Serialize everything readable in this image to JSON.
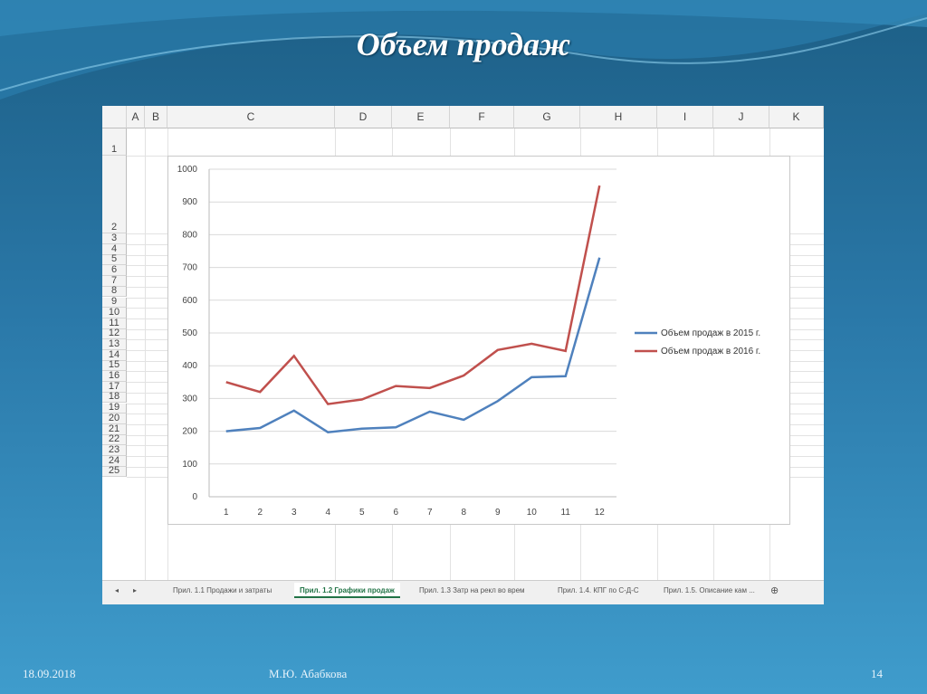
{
  "slide": {
    "title": "Объем продаж",
    "date": "18.09.2018",
    "author": "М.Ю. Абабкова",
    "page": "14"
  },
  "sheet": {
    "columns": [
      "A",
      "B",
      "C",
      "D",
      "E",
      "F",
      "G",
      "H",
      "I",
      "J",
      "K"
    ],
    "rows": [
      "1",
      "2",
      "3",
      "4",
      "5",
      "6",
      "7",
      "8",
      "9",
      "10",
      "11",
      "12",
      "13",
      "14",
      "15",
      "16",
      "17",
      "18",
      "19",
      "20",
      "21",
      "22",
      "23",
      "24",
      "25"
    ],
    "tabs": [
      "Прил. 1.1 Продажи и затраты",
      "Прил. 1.2 Графики продаж",
      "Прил. 1.3 Затр на рекл во врем",
      "Прил. 1.4. КПГ по С-Д-С",
      "Прил. 1.5. Описание кам ..."
    ],
    "active_tab": 1
  },
  "chart_data": {
    "type": "line",
    "title": "",
    "x": [
      1,
      2,
      3,
      4,
      5,
      6,
      7,
      8,
      9,
      10,
      11,
      12
    ],
    "xlabels": [
      "1",
      "2",
      "3",
      "4",
      "5",
      "6",
      "7",
      "8",
      "9",
      "10",
      "11",
      "12"
    ],
    "ylim": [
      0,
      1000
    ],
    "yticks": [
      "0",
      "100",
      "200",
      "300",
      "400",
      "500",
      "600",
      "700",
      "800",
      "900",
      "1000"
    ],
    "grid": true,
    "legend_position": "right",
    "series": [
      {
        "name": "Объем продаж в 2015 г.",
        "color": "#4f81bd",
        "values": [
          200,
          210,
          263,
          197,
          208,
          212,
          260,
          235,
          292,
          365,
          368,
          730
        ]
      },
      {
        "name": "Объем продаж в 2016 г.",
        "color": "#c0504d",
        "values": [
          350,
          320,
          430,
          283,
          297,
          338,
          332,
          370,
          448,
          467,
          445,
          950
        ]
      }
    ]
  }
}
